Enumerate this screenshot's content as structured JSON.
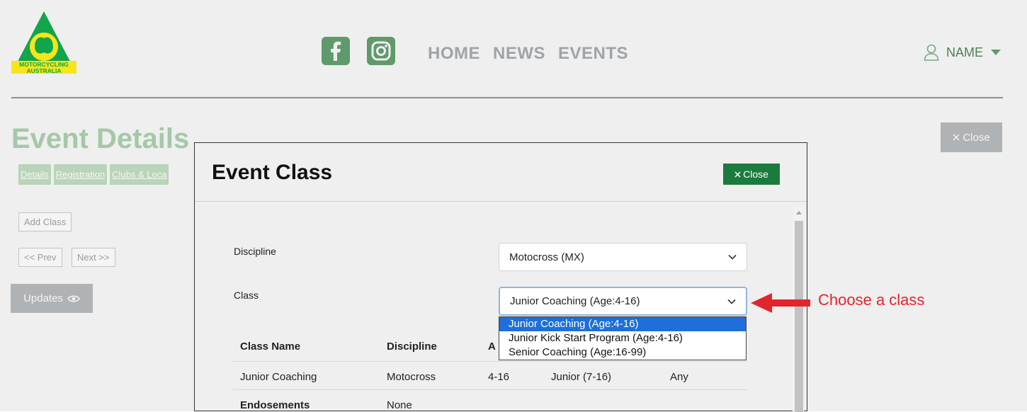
{
  "header": {
    "logo_text_top": "MOTORCYCLING",
    "logo_text_bottom": "AUSTRALIA",
    "nav": [
      "HOME",
      "NEWS",
      "EVENTS"
    ],
    "user_name": "NAME"
  },
  "page": {
    "title": "Event Details",
    "tabs": [
      "Details",
      "Registration",
      "Clubs & Loca"
    ],
    "add_class": "Add Class",
    "prev": "<< Prev",
    "next": "Next >>",
    "updates": "Updates",
    "close": "Close"
  },
  "modal": {
    "title": "Event Class",
    "close": "Close",
    "discipline_label": "Discipline",
    "discipline_value": "Motocross (MX)",
    "class_label": "Class",
    "class_value": "Junior Coaching (Age:4-16)",
    "class_options": [
      "Junior Coaching (Age:4-16)",
      "Junior Kick Start Program (Age:4-16)",
      "Senior Coaching (Age:16-99)"
    ],
    "table": {
      "headers": [
        "Class Name",
        "Discipline",
        "A"
      ],
      "row": [
        "Junior Coaching",
        "Motocross",
        "4-16",
        "Junior (7-16)",
        "Any"
      ],
      "endorsements_label": "Endosements",
      "endorsements_value": "None"
    }
  },
  "annotation": "Choose a class",
  "colors": {
    "brand_green": "#1c7a3e",
    "annotation_red": "#e1252c",
    "selected_option": "#1e6fd9"
  }
}
